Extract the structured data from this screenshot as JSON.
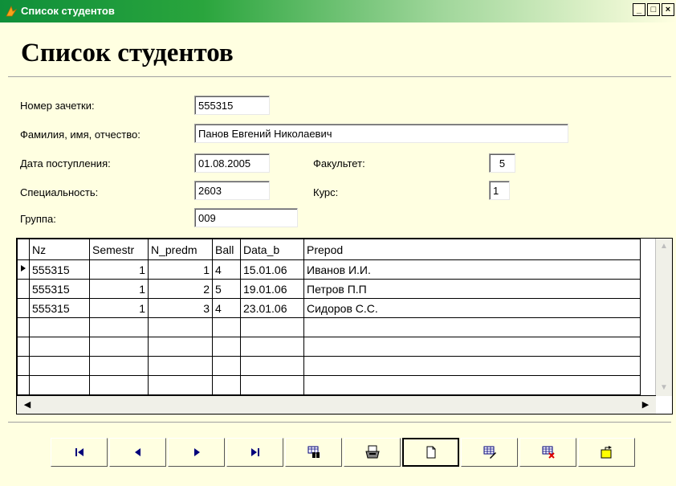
{
  "window": {
    "title": "Список студентов"
  },
  "heading": "Список студентов",
  "form": {
    "zachetka_label": "Номер зачетки:",
    "zachetka_value": "555315",
    "fio_label": "Фамилия, имя, отчество:",
    "fio_value": "Панов Евгений Николаевич",
    "date_label": "Дата поступления:",
    "date_value": "01.08.2005",
    "faculty_label": "Факультет:",
    "faculty_value": "5",
    "spec_label": "Специальность:",
    "spec_value": "2603",
    "course_label": "Курс:",
    "course_value": "1",
    "group_label": "Группа:",
    "group_value": "009"
  },
  "grid": {
    "columns": [
      "Nz",
      "Semestr",
      "N_predm",
      "Ball",
      "Data_b",
      "Prepod"
    ],
    "rows": [
      [
        "555315",
        "1",
        "1",
        "4",
        "15.01.06",
        "Иванов И.И."
      ],
      [
        "555315",
        "1",
        "2",
        "5",
        "19.01.06",
        "Петров П.П"
      ],
      [
        "555315",
        "1",
        "3",
        "4",
        "23.01.06",
        "Сидоров С.С."
      ]
    ]
  },
  "toolbar": {
    "buttons": [
      "first-record",
      "prev-record",
      "next-record",
      "last-record",
      "find",
      "print",
      "new-record",
      "edit-record",
      "delete-record",
      "exit"
    ]
  }
}
